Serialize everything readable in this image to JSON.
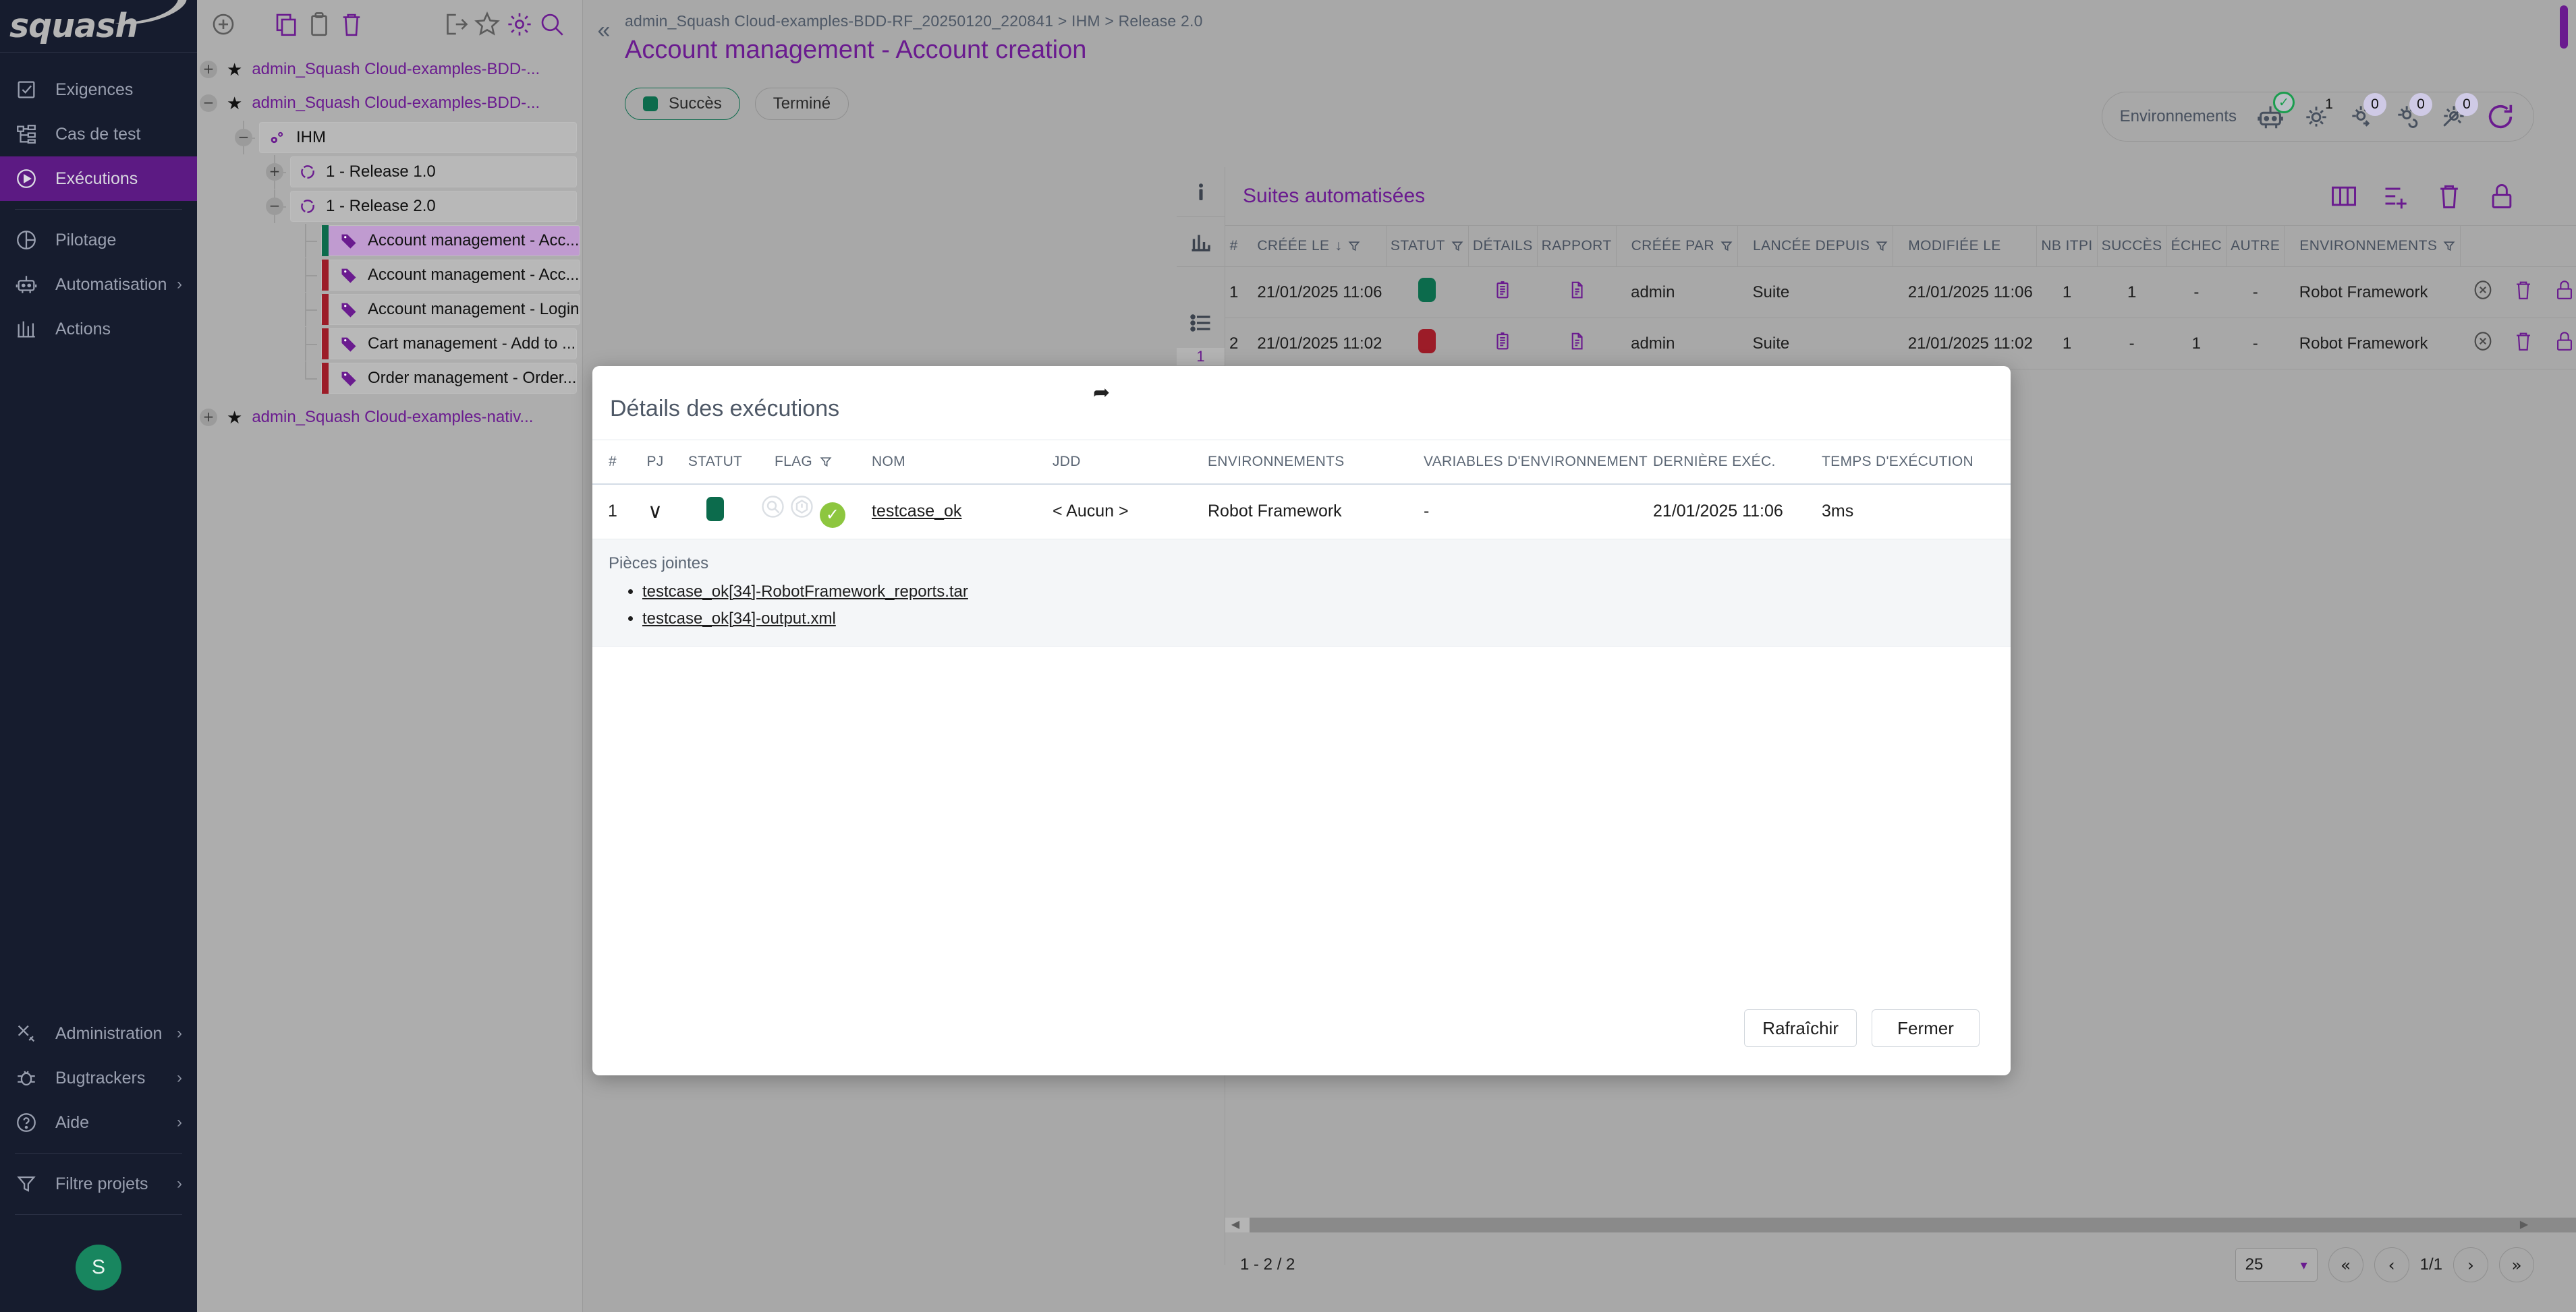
{
  "brand": {
    "logo_text": "squash",
    "accent": "#6a1b8f",
    "nav_active_bg": "#5c1a83"
  },
  "nav": {
    "items": [
      {
        "label": "Exigences",
        "icon": "requirements-checkbox-icon",
        "chevron": ""
      },
      {
        "label": "Cas de test",
        "icon": "test-case-tree-icon",
        "chevron": ""
      },
      {
        "label": "Exécutions",
        "icon": "play-circle-icon",
        "chevron": "",
        "active": true
      },
      {
        "label": "Pilotage",
        "icon": "pie-chart-icon",
        "chevron": ""
      },
      {
        "label": "Automatisation",
        "icon": "robot-icon",
        "chevron": "›"
      },
      {
        "label": "Actions",
        "icon": "columns-icon",
        "chevron": ""
      }
    ],
    "bottom_items": [
      {
        "label": "Administration",
        "icon": "tools-icon",
        "chevron": "›"
      },
      {
        "label": "Bugtrackers",
        "icon": "bug-icon",
        "chevron": "›"
      },
      {
        "label": "Aide",
        "icon": "help-circle-icon",
        "chevron": "›"
      },
      {
        "label": "Filtre projets",
        "icon": "funnel-icon",
        "chevron": "›"
      }
    ],
    "avatar_initial": "S"
  },
  "tree": {
    "toolbar": [
      "add-circle-icon",
      "copy-icon",
      "paste-clipboard-icon",
      "delete-trash-icon",
      "export-icon",
      "star-icon",
      "gear-icon",
      "search-icon"
    ],
    "roots": [
      {
        "expander": "+",
        "label": "admin_Squash Cloud-examples-BDD-..."
      },
      {
        "expander": "−",
        "label": "admin_Squash Cloud-examples-BDD-..."
      }
    ],
    "folder": {
      "expander": "−",
      "label": "IHM",
      "icon": "gears-icon"
    },
    "iterations": [
      {
        "expander": "+",
        "label": "1 - Release 1.0",
        "icon": "iteration-icon"
      },
      {
        "expander": "−",
        "label": "1 - Release 2.0",
        "icon": "iteration-icon"
      }
    ],
    "test_suites": [
      {
        "label": "Account management - Acc...",
        "status_color": "#0c6b4c",
        "selected": true,
        "icon": "tag-icon"
      },
      {
        "label": "Account management - Acc...",
        "status_color": "#9c1c28",
        "selected": false,
        "icon": "tag-icon"
      },
      {
        "label": "Account management - Login",
        "status_color": "#9c1c28",
        "selected": false,
        "icon": "tag-icon"
      },
      {
        "label": "Cart management - Add to ...",
        "status_color": "#9c1c28",
        "selected": false,
        "icon": "tag-icon"
      },
      {
        "label": "Order management - Order...",
        "status_color": "#9c1c28",
        "selected": false,
        "icon": "tag-icon"
      }
    ],
    "root_last": {
      "expander": "+",
      "label": "admin_Squash Cloud-examples-nativ..."
    }
  },
  "header": {
    "collapse_glyph": "«",
    "breadcrumb": "admin_Squash Cloud-examples-BDD-RF_20250120_220841 > IHM > Release 2.0",
    "title": "Account management - Account creation"
  },
  "status_chips": [
    {
      "label": "Succès",
      "has_dot": true,
      "dot_color": "#0c6b4c",
      "selected": true
    },
    {
      "label": "Terminé",
      "has_dot": false,
      "selected": false
    }
  ],
  "environments_bar": {
    "label": "Environnements",
    "icons": [
      {
        "name": "robot-icon",
        "badge": "",
        "check": "✓"
      },
      {
        "name": "gear-icon",
        "badge": "1"
      },
      {
        "name": "gear-arrow-icon",
        "badge": "0"
      },
      {
        "name": "gear-refresh-icon",
        "badge": "0"
      },
      {
        "name": "gear-disabled-icon",
        "badge": "0"
      }
    ],
    "refresh_icon": "refresh-icon"
  },
  "left_rail": {
    "buttons": [
      {
        "name": "info-icon",
        "glyph": "i"
      },
      {
        "name": "chart-bars-icon",
        "glyph": ""
      },
      {
        "name": "list-icon",
        "glyph": ""
      }
    ],
    "count": "1"
  },
  "panel": {
    "title": "Suites automatisées",
    "head_icons": [
      "columns-settings-icon",
      "add-suite-icon",
      "delete-trash-icon",
      "lock-icon"
    ],
    "columns": [
      {
        "key": "num",
        "label": "#",
        "filter": false,
        "sort": false
      },
      {
        "key": "created_on",
        "label": "CRÉÉE LE",
        "sort": true,
        "filter": true
      },
      {
        "key": "status",
        "label": "STATUT",
        "filter": true,
        "sep": true
      },
      {
        "key": "details",
        "label": "DÉTAILS",
        "sep": true
      },
      {
        "key": "report",
        "label": "RAPPORT",
        "sep": true
      },
      {
        "key": "created_by",
        "label": "CRÉÉE PAR",
        "filter": true,
        "sep": true
      },
      {
        "key": "launched_from",
        "label": "LANCÉE DEPUIS",
        "filter": true,
        "sep": true
      },
      {
        "key": "modified_on",
        "label": "MODIFIÉE LE",
        "sep": true
      },
      {
        "key": "nb_itpi",
        "label": "NB ITPI",
        "sep": true
      },
      {
        "key": "success",
        "label": "SUCCÈS",
        "sep": true
      },
      {
        "key": "failure",
        "label": "ÉCHEC",
        "sep": true
      },
      {
        "key": "other",
        "label": "AUTRE",
        "sep": true
      },
      {
        "key": "environments",
        "label": "ENVIRONNEMENTS",
        "filter": true,
        "sep": true
      },
      {
        "key": "actions",
        "label": "",
        "sep": true
      }
    ],
    "rows": [
      {
        "num": "1",
        "created_on": "21/01/2025 11:06",
        "status_color": "#0c6b4c",
        "details_icon": "details-report-icon",
        "report_icon": "file-icon",
        "created_by": "admin",
        "launched_from": "Suite",
        "modified_on": "21/01/2025 11:06",
        "nb_itpi": "1",
        "success": "1",
        "failure": "-",
        "other": "-",
        "environments": "Robot Framework",
        "actions": [
          "cancel-circle-icon",
          "delete-trash-icon",
          "lock-icon",
          "export-doc-icon"
        ]
      },
      {
        "num": "2",
        "created_on": "21/01/2025 11:02",
        "status_color": "#9c1c28",
        "details_icon": "details-report-icon",
        "report_icon": "file-icon",
        "created_by": "admin",
        "launched_from": "Suite",
        "modified_on": "21/01/2025 11:02",
        "nb_itpi": "1",
        "success": "-",
        "failure": "1",
        "other": "-",
        "environments": "Robot Framework",
        "actions": [
          "cancel-circle-icon",
          "delete-trash-icon",
          "lock-icon",
          "export-doc-icon"
        ]
      }
    ]
  },
  "pagination": {
    "count_text": "1 - 2 / 2",
    "page_size": "25",
    "first_glyph": "«",
    "prev_glyph": "‹",
    "page_text": "1/1",
    "next_glyph": "›",
    "last_glyph": "»"
  },
  "modal": {
    "title": "Détails des exécutions",
    "columns": [
      {
        "key": "num",
        "label": "#"
      },
      {
        "key": "pj",
        "label": "PJ"
      },
      {
        "key": "status",
        "label": "STATUT"
      },
      {
        "key": "flag",
        "label": "FLAG",
        "filter": true
      },
      {
        "key": "name",
        "label": "NOM"
      },
      {
        "key": "jdd",
        "label": "JDD"
      },
      {
        "key": "environments",
        "label": "ENVIRONNEMENTS"
      },
      {
        "key": "env_vars",
        "label": "VARIABLES D'ENVIRONNEMENT"
      },
      {
        "key": "last_exec",
        "label": "DERNIÈRE EXÉC."
      },
      {
        "key": "exec_time",
        "label": "TEMPS D'EXÉCUTION"
      }
    ],
    "rows": [
      {
        "num": "1",
        "pj_glyph": "∨",
        "status_color": "#0c6b4c",
        "search_icon": "magnifier-icon",
        "warn_icon": "warning-icon",
        "flag_glyph": "✓",
        "flag_color": "#8dc63f",
        "name": "testcase_ok",
        "jdd": "< Aucun >",
        "environments": "Robot Framework",
        "env_vars": "-",
        "last_exec": "21/01/2025 11:06",
        "exec_time": "3ms"
      }
    ],
    "attachments": {
      "title": "Pièces jointes",
      "files": [
        "testcase_ok[34]-RobotFramework_reports.tar",
        "testcase_ok[34]-output.xml"
      ]
    },
    "footer": {
      "refresh_label": "Rafraîchir",
      "close_label": "Fermer"
    }
  }
}
